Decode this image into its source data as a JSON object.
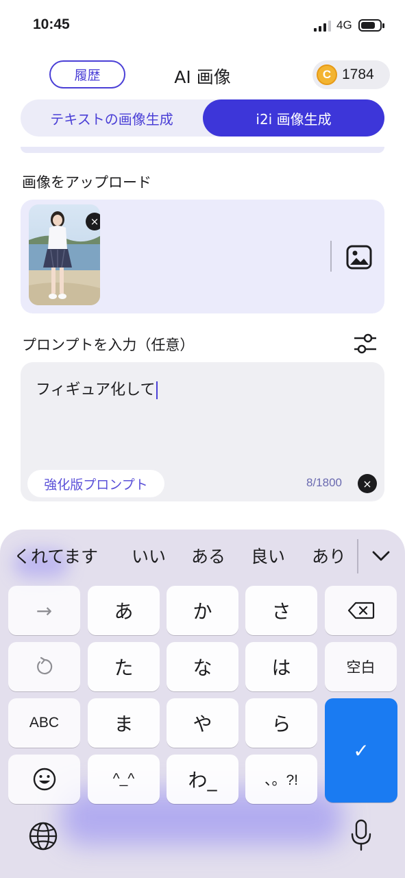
{
  "status_bar": {
    "time": "10:45",
    "network": "4G",
    "battery_level": 0.75
  },
  "header": {
    "history_button": "履歴",
    "title": "AI 画像",
    "coin_balance": "1784",
    "coin_symbol": "C"
  },
  "mode_tabs": [
    {
      "label": "テキストの画像生成",
      "selected": false
    },
    {
      "label": "i2i 画像生成",
      "selected": true
    }
  ],
  "upload": {
    "label": "画像をアップロード",
    "remove_glyph": "×"
  },
  "prompt": {
    "label": "プロンプトを入力（任意）",
    "value": "フィギュア化して",
    "enhance_button": "強化版プロンプト",
    "char_count": "8/1800",
    "clear_glyph": "×"
  },
  "keyboard": {
    "suggestions": [
      "くれてます",
      "いい",
      "ある",
      "良い",
      "あり"
    ],
    "rows": [
      [
        "→",
        "あ",
        "か",
        "さ",
        "⌫"
      ],
      [
        "↺",
        "た",
        "な",
        "は",
        "空白"
      ],
      [
        "ABC",
        "ま",
        "や",
        "ら"
      ],
      [
        "☺",
        "^_^",
        "わ_",
        "、。?!"
      ]
    ],
    "enter_glyph": "✓"
  }
}
